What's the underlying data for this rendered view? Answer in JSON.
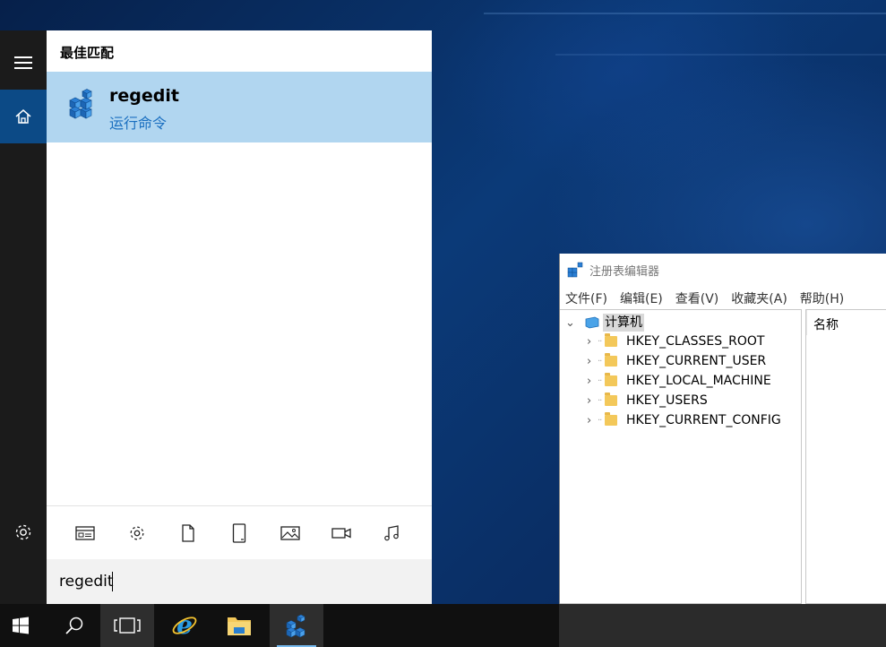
{
  "start_menu": {
    "section_label": "最佳匹配",
    "best_match": {
      "title": "regedit",
      "subtitle": "运行命令"
    },
    "search_query": "regedit",
    "rail_icons": [
      "hamburger-icon",
      "home-icon",
      "settings-icon"
    ],
    "filter_icons": [
      "apps-icon",
      "settings-icon",
      "document-icon",
      "tablet-icon",
      "photo-icon",
      "video-icon",
      "music-icon"
    ]
  },
  "regedit": {
    "title": "注册表编辑器",
    "menu": [
      "文件(F)",
      "编辑(E)",
      "查看(V)",
      "收藏夹(A)",
      "帮助(H)"
    ],
    "root": "计算机",
    "keys": [
      "HKEY_CLASSES_ROOT",
      "HKEY_CURRENT_USER",
      "HKEY_LOCAL_MACHINE",
      "HKEY_USERS",
      "HKEY_CURRENT_CONFIG"
    ],
    "column_name": "名称"
  },
  "taskbar": {
    "items": [
      "windows-start-icon",
      "search-icon",
      "task-view-icon",
      "internet-explorer-icon",
      "file-explorer-icon",
      "regedit-icon"
    ]
  },
  "colors": {
    "accent": "#0c4a86",
    "selection": "#b1d6f0",
    "subtitle": "#1a6fc0"
  }
}
